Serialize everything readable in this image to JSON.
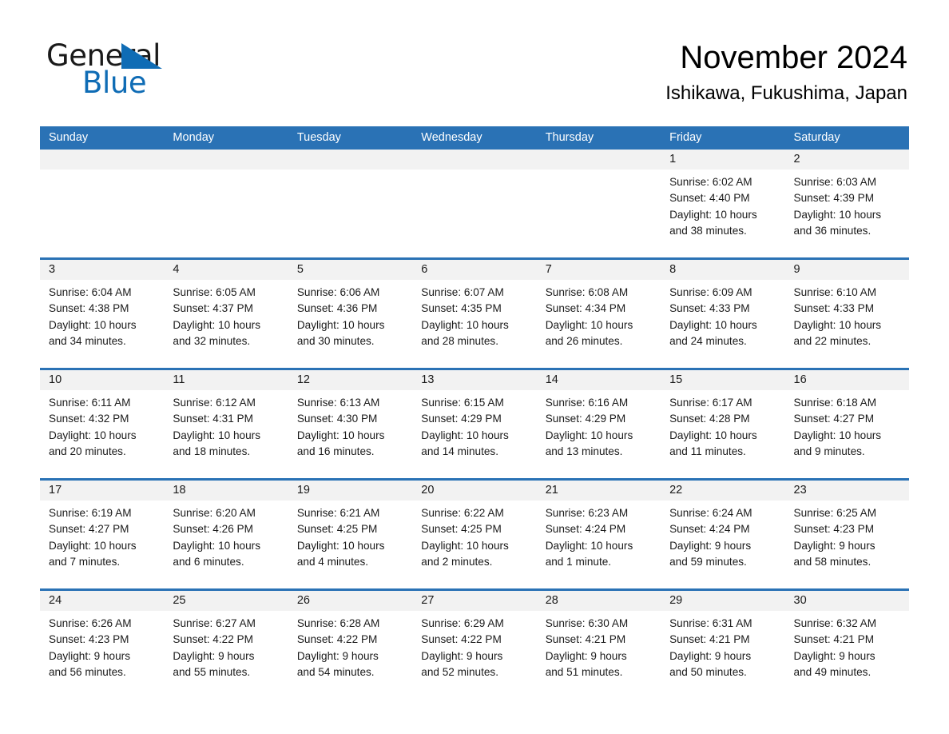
{
  "brand": {
    "name_part1": "General",
    "name_part2": "Blue",
    "accent_color": "#0f6cb5"
  },
  "header": {
    "title": "November 2024",
    "location": "Ishikawa, Fukushima, Japan"
  },
  "theme": {
    "header_blue": "#2a72b5",
    "date_band_gray": "#f2f2f2",
    "text_black": "#1a1a1a"
  },
  "weekdays": [
    "Sunday",
    "Monday",
    "Tuesday",
    "Wednesday",
    "Thursday",
    "Friday",
    "Saturday"
  ],
  "weeks": [
    {
      "days": [
        {
          "date": "",
          "lines": [
            "",
            "",
            "",
            ""
          ]
        },
        {
          "date": "",
          "lines": [
            "",
            "",
            "",
            ""
          ]
        },
        {
          "date": "",
          "lines": [
            "",
            "",
            "",
            ""
          ]
        },
        {
          "date": "",
          "lines": [
            "",
            "",
            "",
            ""
          ]
        },
        {
          "date": "",
          "lines": [
            "",
            "",
            "",
            ""
          ]
        },
        {
          "date": "1",
          "lines": [
            "Sunrise: 6:02 AM",
            "Sunset: 4:40 PM",
            "Daylight: 10 hours",
            "and 38 minutes."
          ]
        },
        {
          "date": "2",
          "lines": [
            "Sunrise: 6:03 AM",
            "Sunset: 4:39 PM",
            "Daylight: 10 hours",
            "and 36 minutes."
          ]
        }
      ]
    },
    {
      "days": [
        {
          "date": "3",
          "lines": [
            "Sunrise: 6:04 AM",
            "Sunset: 4:38 PM",
            "Daylight: 10 hours",
            "and 34 minutes."
          ]
        },
        {
          "date": "4",
          "lines": [
            "Sunrise: 6:05 AM",
            "Sunset: 4:37 PM",
            "Daylight: 10 hours",
            "and 32 minutes."
          ]
        },
        {
          "date": "5",
          "lines": [
            "Sunrise: 6:06 AM",
            "Sunset: 4:36 PM",
            "Daylight: 10 hours",
            "and 30 minutes."
          ]
        },
        {
          "date": "6",
          "lines": [
            "Sunrise: 6:07 AM",
            "Sunset: 4:35 PM",
            "Daylight: 10 hours",
            "and 28 minutes."
          ]
        },
        {
          "date": "7",
          "lines": [
            "Sunrise: 6:08 AM",
            "Sunset: 4:34 PM",
            "Daylight: 10 hours",
            "and 26 minutes."
          ]
        },
        {
          "date": "8",
          "lines": [
            "Sunrise: 6:09 AM",
            "Sunset: 4:33 PM",
            "Daylight: 10 hours",
            "and 24 minutes."
          ]
        },
        {
          "date": "9",
          "lines": [
            "Sunrise: 6:10 AM",
            "Sunset: 4:33 PM",
            "Daylight: 10 hours",
            "and 22 minutes."
          ]
        }
      ]
    },
    {
      "days": [
        {
          "date": "10",
          "lines": [
            "Sunrise: 6:11 AM",
            "Sunset: 4:32 PM",
            "Daylight: 10 hours",
            "and 20 minutes."
          ]
        },
        {
          "date": "11",
          "lines": [
            "Sunrise: 6:12 AM",
            "Sunset: 4:31 PM",
            "Daylight: 10 hours",
            "and 18 minutes."
          ]
        },
        {
          "date": "12",
          "lines": [
            "Sunrise: 6:13 AM",
            "Sunset: 4:30 PM",
            "Daylight: 10 hours",
            "and 16 minutes."
          ]
        },
        {
          "date": "13",
          "lines": [
            "Sunrise: 6:15 AM",
            "Sunset: 4:29 PM",
            "Daylight: 10 hours",
            "and 14 minutes."
          ]
        },
        {
          "date": "14",
          "lines": [
            "Sunrise: 6:16 AM",
            "Sunset: 4:29 PM",
            "Daylight: 10 hours",
            "and 13 minutes."
          ]
        },
        {
          "date": "15",
          "lines": [
            "Sunrise: 6:17 AM",
            "Sunset: 4:28 PM",
            "Daylight: 10 hours",
            "and 11 minutes."
          ]
        },
        {
          "date": "16",
          "lines": [
            "Sunrise: 6:18 AM",
            "Sunset: 4:27 PM",
            "Daylight: 10 hours",
            "and 9 minutes."
          ]
        }
      ]
    },
    {
      "days": [
        {
          "date": "17",
          "lines": [
            "Sunrise: 6:19 AM",
            "Sunset: 4:27 PM",
            "Daylight: 10 hours",
            "and 7 minutes."
          ]
        },
        {
          "date": "18",
          "lines": [
            "Sunrise: 6:20 AM",
            "Sunset: 4:26 PM",
            "Daylight: 10 hours",
            "and 6 minutes."
          ]
        },
        {
          "date": "19",
          "lines": [
            "Sunrise: 6:21 AM",
            "Sunset: 4:25 PM",
            "Daylight: 10 hours",
            "and 4 minutes."
          ]
        },
        {
          "date": "20",
          "lines": [
            "Sunrise: 6:22 AM",
            "Sunset: 4:25 PM",
            "Daylight: 10 hours",
            "and 2 minutes."
          ]
        },
        {
          "date": "21",
          "lines": [
            "Sunrise: 6:23 AM",
            "Sunset: 4:24 PM",
            "Daylight: 10 hours",
            "and 1 minute."
          ]
        },
        {
          "date": "22",
          "lines": [
            "Sunrise: 6:24 AM",
            "Sunset: 4:24 PM",
            "Daylight: 9 hours",
            "and 59 minutes."
          ]
        },
        {
          "date": "23",
          "lines": [
            "Sunrise: 6:25 AM",
            "Sunset: 4:23 PM",
            "Daylight: 9 hours",
            "and 58 minutes."
          ]
        }
      ]
    },
    {
      "days": [
        {
          "date": "24",
          "lines": [
            "Sunrise: 6:26 AM",
            "Sunset: 4:23 PM",
            "Daylight: 9 hours",
            "and 56 minutes."
          ]
        },
        {
          "date": "25",
          "lines": [
            "Sunrise: 6:27 AM",
            "Sunset: 4:22 PM",
            "Daylight: 9 hours",
            "and 55 minutes."
          ]
        },
        {
          "date": "26",
          "lines": [
            "Sunrise: 6:28 AM",
            "Sunset: 4:22 PM",
            "Daylight: 9 hours",
            "and 54 minutes."
          ]
        },
        {
          "date": "27",
          "lines": [
            "Sunrise: 6:29 AM",
            "Sunset: 4:22 PM",
            "Daylight: 9 hours",
            "and 52 minutes."
          ]
        },
        {
          "date": "28",
          "lines": [
            "Sunrise: 6:30 AM",
            "Sunset: 4:21 PM",
            "Daylight: 9 hours",
            "and 51 minutes."
          ]
        },
        {
          "date": "29",
          "lines": [
            "Sunrise: 6:31 AM",
            "Sunset: 4:21 PM",
            "Daylight: 9 hours",
            "and 50 minutes."
          ]
        },
        {
          "date": "30",
          "lines": [
            "Sunrise: 6:32 AM",
            "Sunset: 4:21 PM",
            "Daylight: 9 hours",
            "and 49 minutes."
          ]
        }
      ]
    }
  ]
}
